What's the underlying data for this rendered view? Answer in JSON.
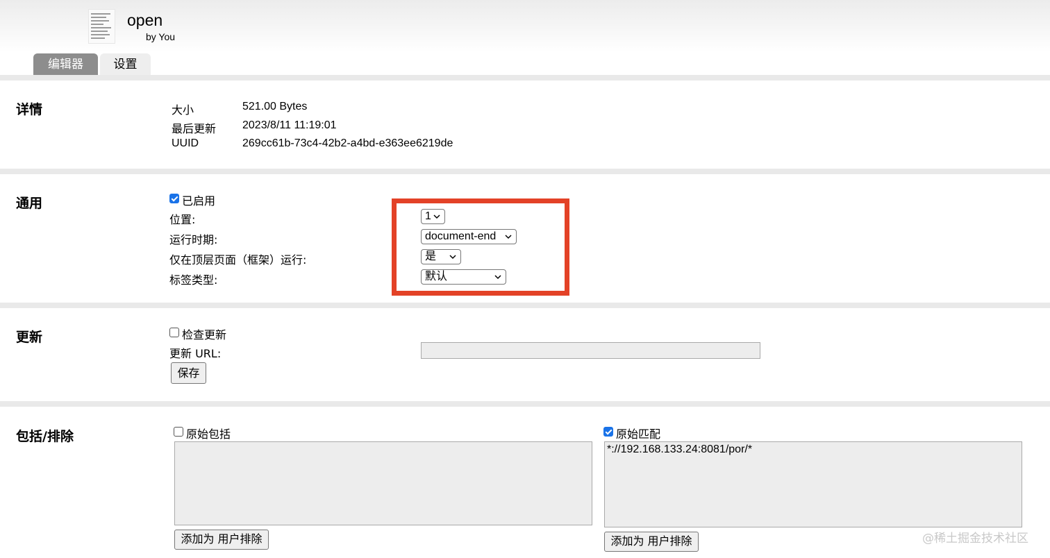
{
  "header": {
    "script_name": "open",
    "author": "by You",
    "icon": "script-file-icon"
  },
  "tabs": [
    {
      "label": "编辑器",
      "active": true
    },
    {
      "label": "设置",
      "active": false
    }
  ],
  "details": {
    "title": "详情",
    "rows": [
      {
        "label": "大小",
        "value": "521.00 Bytes"
      },
      {
        "label": "最后更新",
        "value": "2023/8/11 11:19:01"
      },
      {
        "label": "UUID",
        "value": "269cc61b-73c4-42b2-a4bd-e363ee6219de"
      }
    ]
  },
  "general": {
    "title": "通用",
    "enabled_label": "已启用",
    "enabled": true,
    "fields": [
      {
        "label": "位置:",
        "value": "1"
      },
      {
        "label": "运行时期:",
        "value": "document-end"
      },
      {
        "label": "仅在顶层页面（框架）运行:",
        "value": "是"
      },
      {
        "label": "标签类型:",
        "value": "默认"
      }
    ],
    "highlight_color": "#e34227"
  },
  "update": {
    "title": "更新",
    "check_label": "检查更新",
    "check": false,
    "url_label": "更新 URL:",
    "url_value": "",
    "save_label": "保存"
  },
  "include_exclude": {
    "title": "包括/排除",
    "left": {
      "checkbox_label": "原始包括",
      "checked": false,
      "content": "",
      "button_label": "添加为 用户排除"
    },
    "right": {
      "checkbox_label": "原始匹配",
      "checked": true,
      "content": "*://192.168.133.24:8081/por/*",
      "button_label": "添加为 用户排除"
    }
  },
  "watermark": "@稀土掘金技术社区",
  "colors": {
    "active_tab": "#8d8d8d",
    "checkbox": "#1a73e8",
    "separator": "#e9e9e9"
  }
}
